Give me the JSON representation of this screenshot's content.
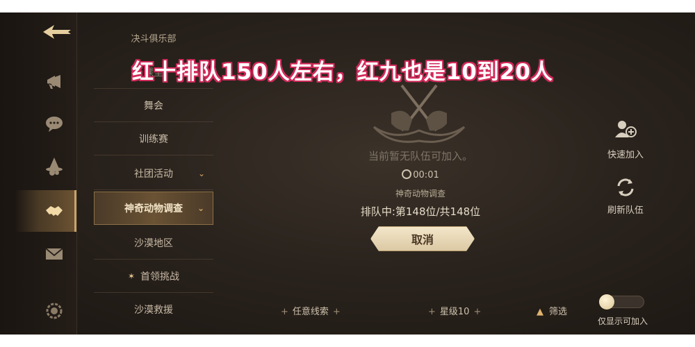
{
  "overlay": {
    "title": "红十排队150人左右，红九也是10到20人"
  },
  "submenu": {
    "header": "决斗俱乐部",
    "items": [
      {
        "label": "课堂",
        "state": "dim"
      },
      {
        "label": "舞会",
        "state": "normal"
      },
      {
        "label": "训练赛",
        "state": "normal"
      },
      {
        "label": "社团活动",
        "state": "normal",
        "chevron": "⌄"
      },
      {
        "label": "神奇动物调查",
        "state": "active",
        "chevron": "⌄"
      },
      {
        "label": "沙漠地区",
        "state": "normal"
      },
      {
        "label": "首领挑战",
        "state": "normal",
        "star": "✶"
      },
      {
        "label": "沙漠救援",
        "state": "normal"
      }
    ]
  },
  "center": {
    "no_team_text": "当前暂无队伍可加入。",
    "timer": "00:01",
    "activity_name": "神奇动物调查",
    "queue_status": "排队中:第148位/共148位",
    "cancel_label": "取消"
  },
  "side_actions": {
    "quick_join_label": "快速加入",
    "refresh_label": "刷新队伍"
  },
  "filters": {
    "clue_label": "任意线索",
    "star_label": "星级10",
    "filter_label": "筛选",
    "toggle_label": "仅显示可加入",
    "toggle_on": false
  },
  "icons": [
    "back-arrow-icon",
    "megaphone-icon",
    "chat-bubble-icon",
    "wizard-hat-icon",
    "handshake-icon",
    "mail-icon",
    "gear-icon",
    "quick-join-icon",
    "refresh-icon",
    "timer-icon",
    "crossed-wands-icon"
  ],
  "colors": {
    "accent_gold": "#c7a46a",
    "overlay_text_stroke": "#d22a5a",
    "button_bg": "#f3e6c9"
  }
}
